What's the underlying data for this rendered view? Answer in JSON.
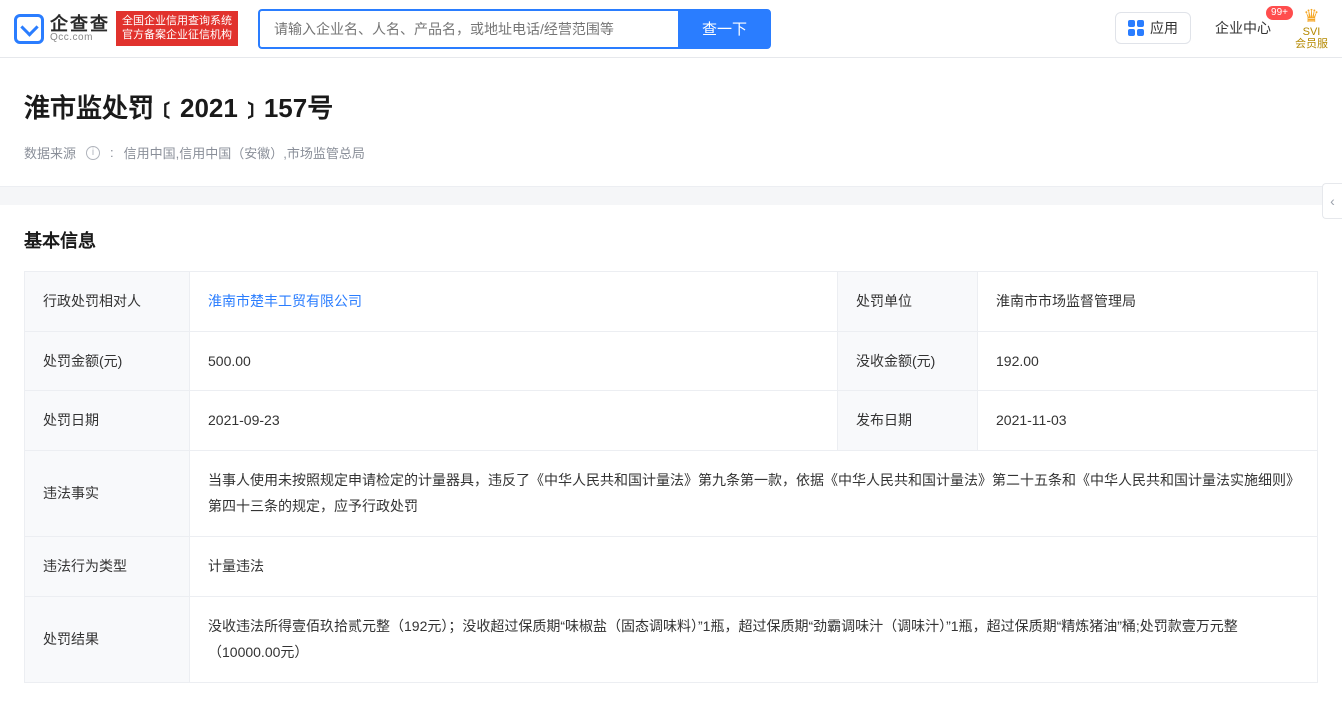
{
  "header": {
    "logo_cn": "企查查",
    "logo_en": "Qcc.com",
    "logo_badge_line1": "全国企业信用查询系统",
    "logo_badge_line2": "官方备案企业征信机构",
    "search_placeholder": "请输入企业名、人名、产品名，或地址电话/经营范围等",
    "search_button": "查一下",
    "app_label": "应用",
    "center_label": "企业中心",
    "badge_count": "99+",
    "vip_top": "SVI",
    "vip_bottom": "会员服"
  },
  "title": {
    "heading": "淮市监处罚﹝2021﹞157号",
    "source_label": "数据来源",
    "source_value": "信用中国,信用中国（安徽）,市场监管总局"
  },
  "section_title": "基本信息",
  "fields": {
    "party_label": "行政处罚相对人",
    "party_value": "淮南市楚丰工贸有限公司",
    "authority_label": "处罚单位",
    "authority_value": "淮南市市场监督管理局",
    "fine_label": "处罚金额(元)",
    "fine_value": "500.00",
    "confiscate_label": "没收金额(元)",
    "confiscate_value": "192.00",
    "penalty_date_label": "处罚日期",
    "penalty_date_value": "2021-09-23",
    "publish_date_label": "发布日期",
    "publish_date_value": "2021-11-03",
    "facts_label": "违法事实",
    "facts_value": "当事人使用未按照规定申请检定的计量器具，违反了《中华人民共和国计量法》第九条第一款，依据《中华人民共和国计量法》第二十五条和《中华人民共和国计量法实施细则》第四十三条的规定，应予行政处罚",
    "type_label": "违法行为类型",
    "type_value": "计量违法",
    "result_label": "处罚结果",
    "result_value": "没收违法所得壹佰玖拾贰元整（192元）；没收超过保质期“味椒盐（固态调味料）”1瓶，超过保质期“劲霸调味汁（调味汁）”1瓶，超过保质期“精炼猪油”桶;处罚款壹万元整（10000.00元）"
  }
}
